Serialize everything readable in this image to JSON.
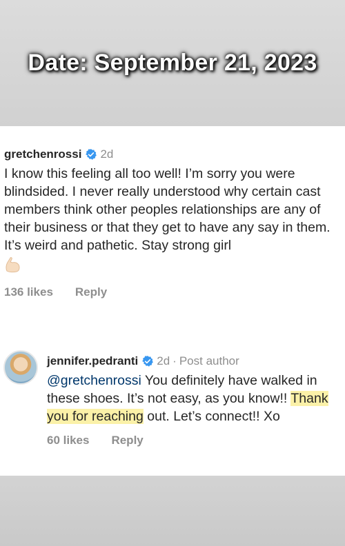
{
  "caption": {
    "date": "Date: September 21, 2023"
  },
  "comments": [
    {
      "username": "gretchenrossi",
      "time": "2d",
      "text": "I know this feeling all too well! I’m sorry you were blindsided. I never really understood why certain cast members think other peoples relationships are any of their business or that they get to have any say in them. It’s weird and pathetic. Stay strong girl",
      "emoji": "💪🏻",
      "likes": "136 likes",
      "reply": "Reply"
    },
    {
      "username": "jennifer.pedranti",
      "time": "2d",
      "separator": "·",
      "badge": "Post author",
      "mention": "@gretchenrossi",
      "text_before_highlight": " You definitely have walked in these shoes. It’s not easy, as you know!! ",
      "highlight": "Thank you for reaching",
      "text_after_highlight": " out. Let’s connect!! Xo",
      "likes": "60 likes",
      "reply": "Reply"
    }
  ],
  "colors": {
    "verified": "#3897f0",
    "highlight": "#fbf1a8",
    "mention": "#00376b"
  },
  "icons": [
    "verified-badge-icon",
    "flexed-biceps-emoji",
    "avatar"
  ]
}
